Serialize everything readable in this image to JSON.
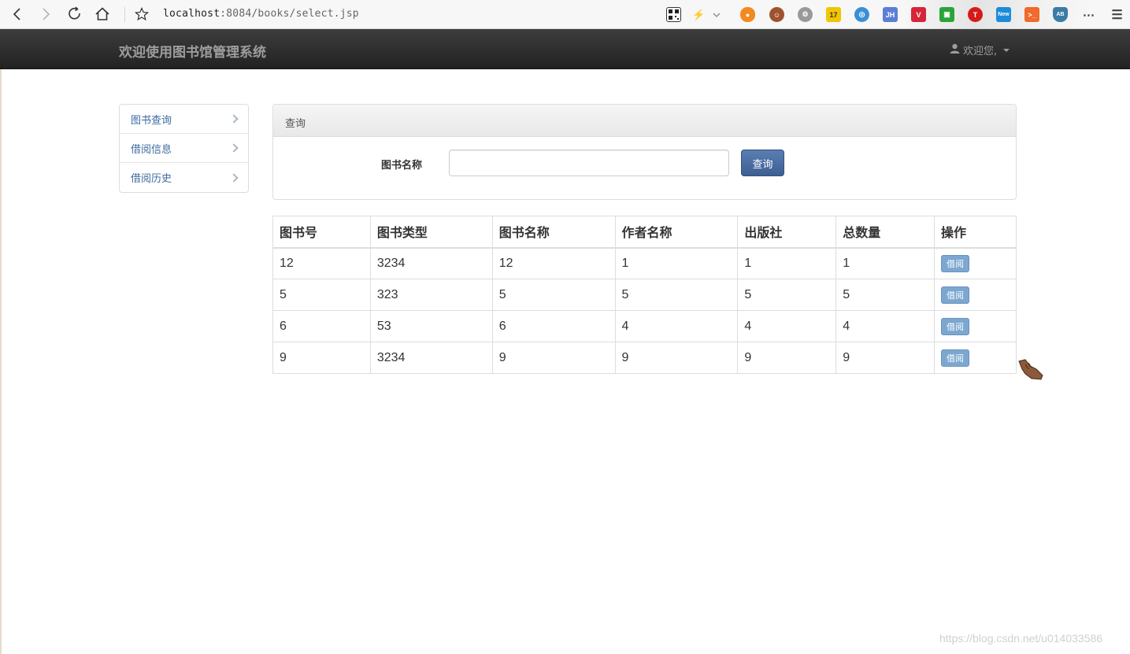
{
  "browser": {
    "url_host": "localhost",
    "url_rest": ":8084/books/select.jsp"
  },
  "navbar": {
    "brand": "欢迎使用图书馆管理系统",
    "user_label": "欢迎您,"
  },
  "sidebar": {
    "items": [
      {
        "label": "图书查询"
      },
      {
        "label": "借阅信息"
      },
      {
        "label": "借阅历史"
      }
    ]
  },
  "search_panel": {
    "heading": "查询",
    "field_label": "图书名称",
    "input_value": "",
    "button_label": "查询"
  },
  "table": {
    "headers": [
      "图书号",
      "图书类型",
      "图书名称",
      "作者名称",
      "出版社",
      "总数量",
      "操作"
    ],
    "rows": [
      {
        "id": "12",
        "type": "3234",
        "name": "12",
        "author": "1",
        "publisher": "1",
        "total": "1",
        "action": "借阅"
      },
      {
        "id": "5",
        "type": "323",
        "name": "5",
        "author": "5",
        "publisher": "5",
        "total": "5",
        "action": "借阅"
      },
      {
        "id": "6",
        "type": "53",
        "name": "6",
        "author": "4",
        "publisher": "4",
        "total": "4",
        "action": "借阅"
      },
      {
        "id": "9",
        "type": "3234",
        "name": "9",
        "author": "9",
        "publisher": "9",
        "total": "9",
        "action": "借阅"
      }
    ]
  },
  "watermark": "https://blog.csdn.net/u014033586",
  "colors": {
    "navbar": "#222222",
    "primary_button": "#3d5f93",
    "borrow_button": "#7ba7d0",
    "sidebar_link": "#3d6a9e"
  }
}
